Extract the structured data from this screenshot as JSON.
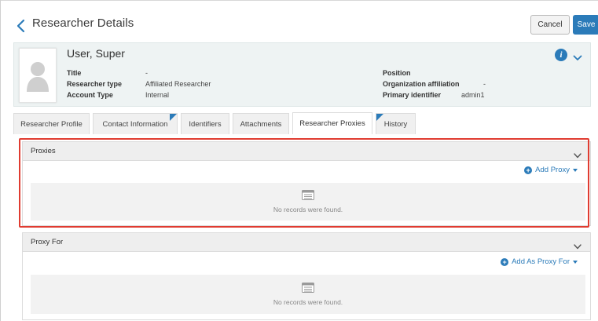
{
  "header": {
    "title": "Researcher Details",
    "cancel_label": "Cancel",
    "save_label": "Save"
  },
  "profile": {
    "name": "User, Super",
    "left_fields": [
      {
        "label": "Title",
        "value": "-"
      },
      {
        "label": "Researcher type",
        "value": "Affiliated Researcher"
      },
      {
        "label": "Account Type",
        "value": "Internal"
      }
    ],
    "right_fields": [
      {
        "label": "Position",
        "value": ""
      },
      {
        "label": "Organization affiliation",
        "value": "-"
      },
      {
        "label": "Primary identifier",
        "value": "admin1"
      }
    ]
  },
  "tabs": [
    {
      "label": "Researcher Profile",
      "active": false,
      "flagged": false
    },
    {
      "label": "Contact Information",
      "active": false,
      "flagged": true
    },
    {
      "label": "Identifiers",
      "active": false,
      "flagged": false
    },
    {
      "label": "Attachments",
      "active": false,
      "flagged": false
    },
    {
      "label": "Researcher Proxies",
      "active": true,
      "flagged": false
    },
    {
      "label": "History",
      "active": false,
      "flagged": true
    }
  ],
  "proxies": {
    "title": "Proxies",
    "add_label": "Add Proxy",
    "empty_text": "No records were found."
  },
  "proxy_for": {
    "title": "Proxy For",
    "add_label": "Add As Proxy For",
    "empty_text": "No records were found."
  },
  "colors": {
    "accent": "#2b7bb9",
    "highlight": "#e03c31",
    "profile_bg": "#eef3f3"
  },
  "icons": {
    "back": "chevron-left-icon",
    "info": "info-icon",
    "collapse": "chevron-down-icon",
    "avatar": "user-silhouette-icon",
    "empty": "list-icon",
    "add": "plus-circle-icon"
  }
}
